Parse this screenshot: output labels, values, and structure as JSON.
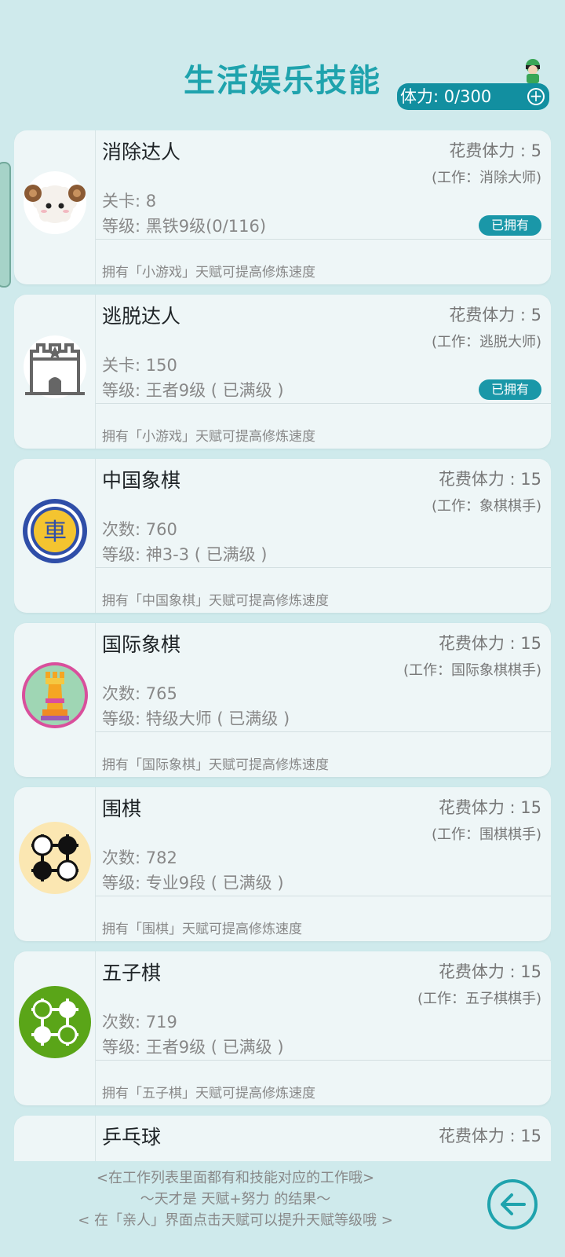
{
  "header": {
    "title": "生活娱乐技能",
    "stamina_label": "体力: 0/300",
    "plus": "+"
  },
  "skills": [
    {
      "name": "消除达人",
      "cost": "花费体力 : 5",
      "job": "(工作：消除大师)",
      "count": "关卡: 8",
      "level": "等级: 黑铁9级(0/116)",
      "badge": "已拥有",
      "hint": "拥有「小游戏」天赋可提高修炼速度",
      "icon": "sheep-icon"
    },
    {
      "name": "逃脱达人",
      "cost": "花费体力 : 5",
      "job": "(工作：逃脱大师)",
      "count": "关卡: 150",
      "level": "等级: 王者9级 ( 已满级 )",
      "badge": "已拥有",
      "hint": "拥有「小游戏」天赋可提高修炼速度",
      "icon": "castle-icon"
    },
    {
      "name": "中国象棋",
      "cost": "花费体力 : 15",
      "job": "(工作：象棋棋手)",
      "count": "次数: 760",
      "level": "等级: 神3-3 ( 已满级 )",
      "hint": "拥有「中国象棋」天赋可提高修炼速度",
      "icon": "xiangqi-chariot-icon",
      "piece_char": "車"
    },
    {
      "name": "国际象棋",
      "cost": "花费体力 : 15",
      "job": "(工作：国际象棋棋手)",
      "count": "次数: 765",
      "level": "等级: 特级大师 ( 已满级 )",
      "hint": "拥有「国际象棋」天赋可提高修炼速度",
      "icon": "chess-rook-icon"
    },
    {
      "name": "围棋",
      "cost": "花费体力 : 15",
      "job": "(工作：围棋棋手)",
      "count": "次数: 782",
      "level": "等级: 专业9段 ( 已满级 )",
      "hint": "拥有「围棋」天赋可提高修炼速度",
      "icon": "go-stones-icon"
    },
    {
      "name": "五子棋",
      "cost": "花费体力 : 15",
      "job": "(工作：五子棋棋手)",
      "count": "次数: 719",
      "level": "等级: 王者9级 ( 已满级 )",
      "hint": "拥有「五子棋」天赋可提高修炼速度",
      "icon": "gomoku-icon"
    },
    {
      "name": "乒乓球",
      "cost": "花费体力 : 15"
    }
  ],
  "footer": {
    "line1": "<在工作列表里面都有和技能对应的工作哦>",
    "line2": "～天才是 天赋+努力 的结果～",
    "line3": "< 在「亲人」界面点击天赋可以提升天赋等级哦 >"
  },
  "colors": {
    "accent": "#1fa3ad",
    "badge": "#1a97a8",
    "background": "#cfeaec",
    "card": "#eef6f7"
  }
}
